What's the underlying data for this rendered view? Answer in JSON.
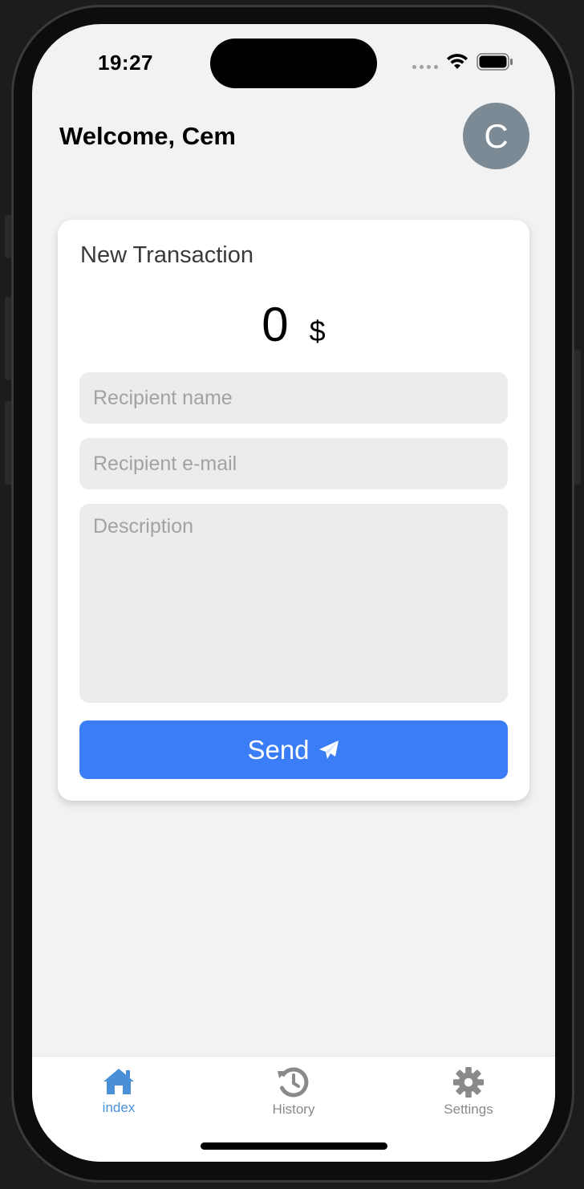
{
  "status_bar": {
    "time": "19:27"
  },
  "header": {
    "welcome": "Welcome, Cem",
    "avatar_initial": "C"
  },
  "card": {
    "title": "New Transaction",
    "amount": "0",
    "currency": "$",
    "recipient_name": {
      "placeholder": "Recipient name",
      "value": ""
    },
    "recipient_email": {
      "placeholder": "Recipient e-mail",
      "value": ""
    },
    "description": {
      "placeholder": "Description",
      "value": ""
    },
    "send_label": "Send"
  },
  "tabbar": {
    "active_color": "#4a90d9",
    "inactive_color": "#8a8a8a",
    "items": [
      {
        "label": "index",
        "icon": "home-icon",
        "active": true
      },
      {
        "label": "History",
        "icon": "history-icon",
        "active": false
      },
      {
        "label": "Settings",
        "icon": "gear-icon",
        "active": false
      }
    ]
  },
  "colors": {
    "accent": "#3a7df6",
    "avatar_bg": "#7b8a95"
  }
}
